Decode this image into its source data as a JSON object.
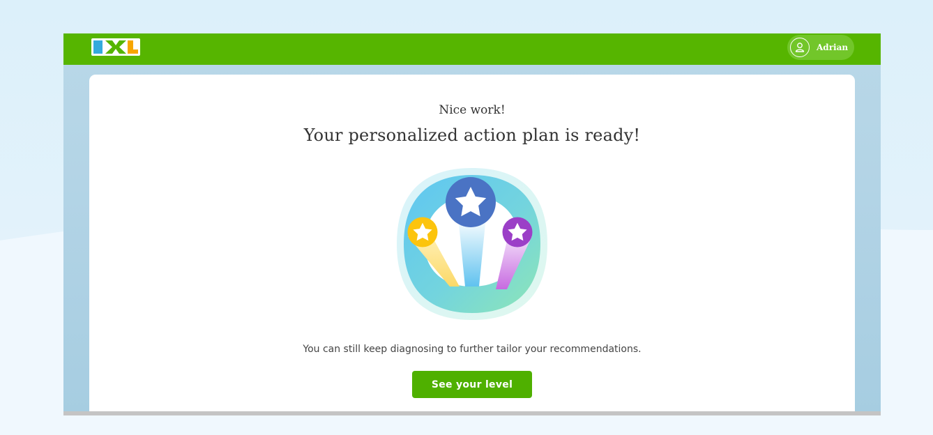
{
  "header": {
    "logo_text": "IXL",
    "user": {
      "name": "Adrian",
      "icon": "user-icon"
    }
  },
  "card": {
    "subtitle": "Nice work!",
    "title": "Your personalized action plan is ready!",
    "illustration": {
      "icons": [
        "star-icon",
        "star-icon",
        "star-icon"
      ]
    },
    "description": "You can still keep diagnosing to further tailor your recommendations.",
    "cta_label": "See your level"
  },
  "colors": {
    "topbar": "#56b500",
    "cta": "#4fb000",
    "star_blue": "#4a73c4",
    "star_yellow": "#fcc40d",
    "star_purple": "#9b3fc7"
  }
}
